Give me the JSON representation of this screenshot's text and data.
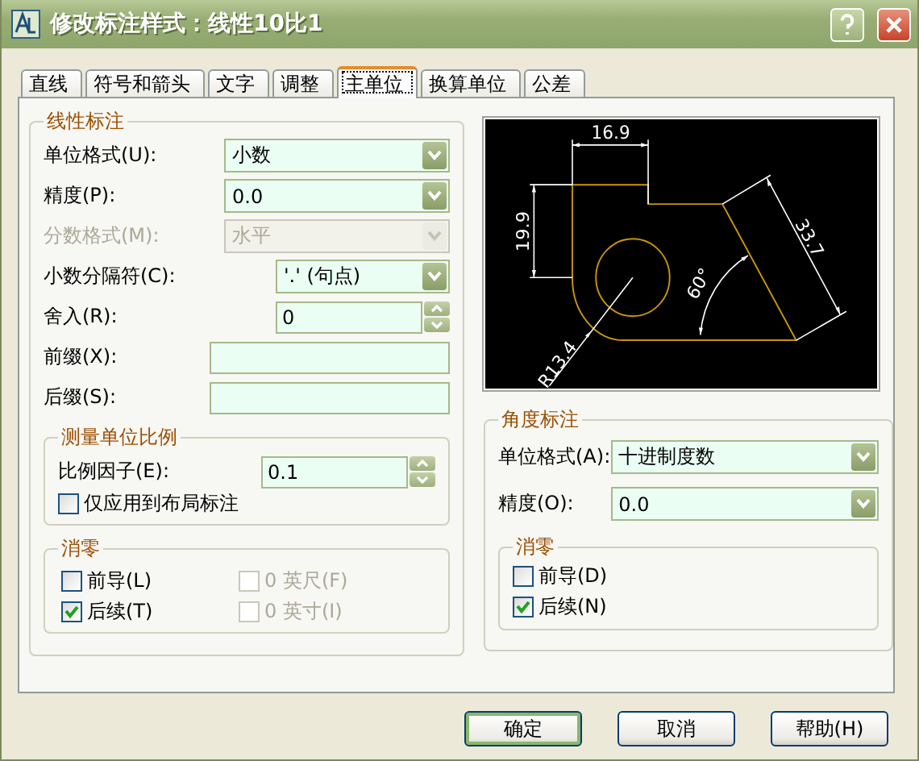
{
  "window": {
    "title": "修改标注样式：线性10比1"
  },
  "tabs": [
    {
      "label": "直线",
      "selected": false
    },
    {
      "label": "符号和箭头",
      "selected": false
    },
    {
      "label": "文字",
      "selected": false
    },
    {
      "label": "调整",
      "selected": false
    },
    {
      "label": "主单位",
      "selected": true
    },
    {
      "label": "换算单位",
      "selected": false
    },
    {
      "label": "公差",
      "selected": false
    }
  ],
  "linear": {
    "title": "线性标注",
    "fields": [
      {
        "kind": "select",
        "label": "单位格式(U):",
        "value": "小数"
      },
      {
        "kind": "select",
        "label": "精度(P):",
        "value": "0.0"
      },
      {
        "kind": "select",
        "label": "分数格式(M):",
        "value": "水平",
        "disabled": true
      },
      {
        "kind": "select-short",
        "label": "小数分隔符(C):",
        "value": "'.' (句点)"
      },
      {
        "kind": "spin-short",
        "label": "舍入(R):",
        "value": "0"
      },
      {
        "kind": "text",
        "label": "前缀(X):"
      },
      {
        "kind": "text",
        "label": "后缀(S):"
      }
    ],
    "scale": {
      "title": "测量单位比例",
      "label": "比例因子(E):",
      "value": "0.1",
      "layout_only": {
        "label": "仅应用到布局标注",
        "checked": false
      }
    },
    "zero": {
      "title": "消零",
      "checks": [
        {
          "label": "前导(L)",
          "checked": false,
          "disabled": false
        },
        {
          "label": "0 英尺(F)",
          "checked": false,
          "disabled": true
        },
        {
          "label": "后续(T)",
          "checked": true,
          "disabled": false
        },
        {
          "label": "0 英寸(I)",
          "checked": false,
          "disabled": true
        }
      ]
    }
  },
  "preview": {
    "labels": [
      "16.9",
      "19.9",
      "33.7",
      "60°",
      "R13.4"
    ]
  },
  "angular": {
    "title": "角度标注",
    "fields": [
      {
        "kind": "select-wide",
        "label": "单位格式(A):",
        "value": "十进制度数"
      },
      {
        "kind": "select-wide",
        "label": "精度(O):",
        "value": "0.0"
      }
    ],
    "zero": {
      "title": "消零",
      "checks": [
        {
          "label": "前导(D)",
          "checked": false,
          "disabled": false
        },
        {
          "label": "后续(N)",
          "checked": true,
          "disabled": false
        }
      ]
    }
  },
  "buttons": [
    {
      "label": "确定",
      "default": true
    },
    {
      "label": "取消",
      "default": false
    },
    {
      "label": "帮助(H)",
      "default": false
    }
  ]
}
